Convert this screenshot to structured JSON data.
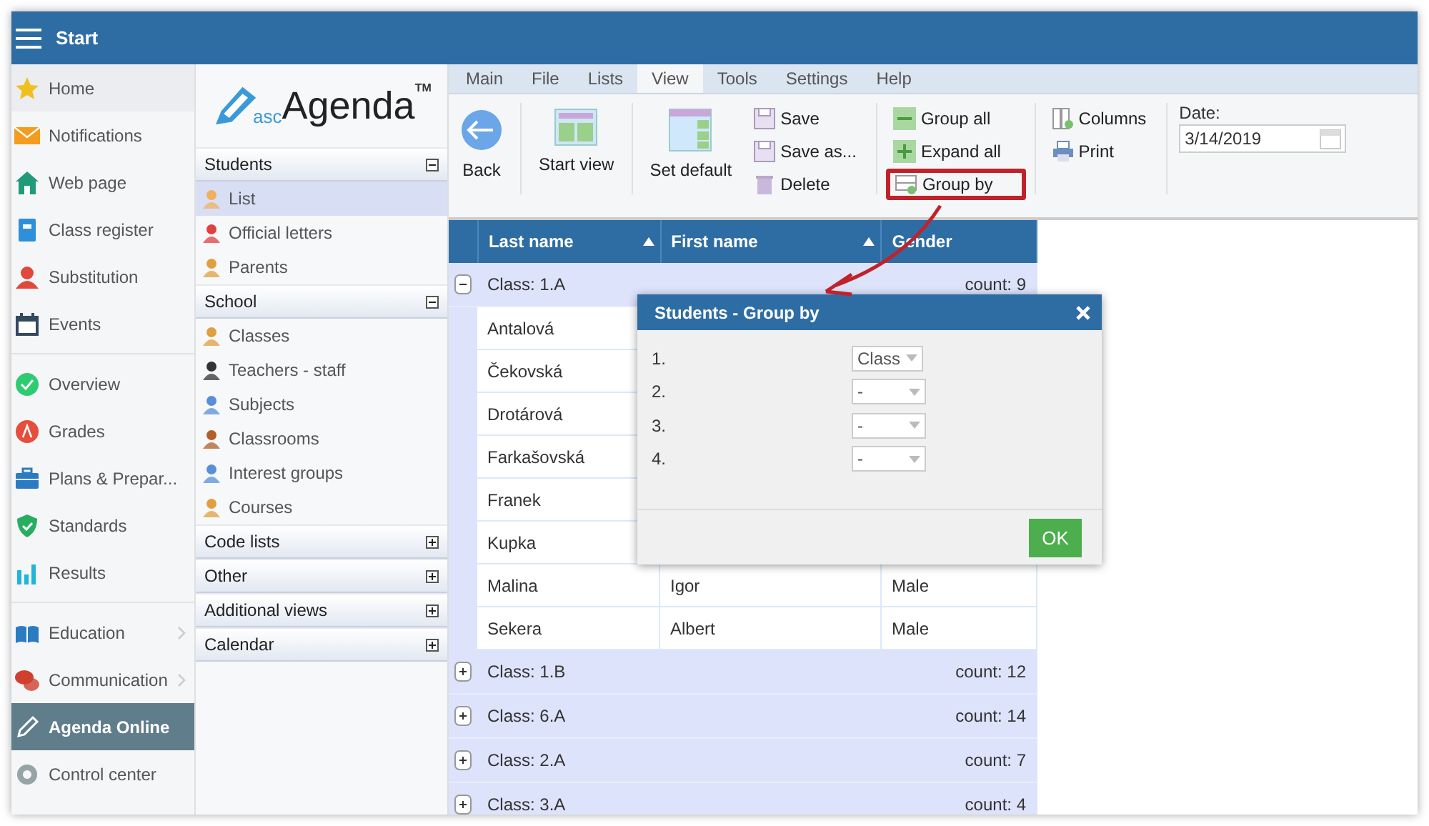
{
  "app_bar": {
    "title": "Start"
  },
  "nav_groups": [
    [
      {
        "label": "Home",
        "selected": false,
        "submenu": false
      },
      {
        "label": "Notifications",
        "selected": false,
        "submenu": false
      },
      {
        "label": "Web page",
        "selected": false,
        "submenu": false
      },
      {
        "label": "Class register",
        "selected": false,
        "submenu": false
      },
      {
        "label": "Substitution",
        "selected": false,
        "submenu": false
      },
      {
        "label": "Events",
        "selected": false,
        "submenu": false
      }
    ],
    [
      {
        "label": "Overview",
        "selected": false,
        "submenu": false
      },
      {
        "label": "Grades",
        "selected": false,
        "submenu": false
      },
      {
        "label": "Plans & Prepar...",
        "selected": false,
        "submenu": false
      },
      {
        "label": "Standards",
        "selected": false,
        "submenu": false
      },
      {
        "label": "Results",
        "selected": false,
        "submenu": false
      }
    ],
    [
      {
        "label": "Education",
        "selected": false,
        "submenu": true
      },
      {
        "label": "Communication",
        "selected": false,
        "submenu": true
      },
      {
        "label": "Agenda Online",
        "selected": true,
        "submenu": false
      },
      {
        "label": "Control center",
        "selected": false,
        "submenu": false
      }
    ]
  ],
  "logo": {
    "prefix": "asc",
    "name": "Agenda",
    "mark": "TM"
  },
  "sections": [
    {
      "title": "Students",
      "expanded": true,
      "items": [
        {
          "label": "List",
          "selected": true
        },
        {
          "label": "Official letters",
          "selected": false
        },
        {
          "label": "Parents",
          "selected": false
        }
      ]
    },
    {
      "title": "School",
      "expanded": true,
      "items": [
        {
          "label": "Classes",
          "selected": false
        },
        {
          "label": "Teachers - staff",
          "selected": false
        },
        {
          "label": "Subjects",
          "selected": false
        },
        {
          "label": "Classrooms",
          "selected": false
        },
        {
          "label": "Interest groups",
          "selected": false
        },
        {
          "label": "Courses",
          "selected": false
        }
      ]
    },
    {
      "title": "Code lists",
      "expanded": false
    },
    {
      "title": "Other",
      "expanded": false
    },
    {
      "title": "Additional views",
      "expanded": false
    },
    {
      "title": "Calendar",
      "expanded": false
    }
  ],
  "menu_tabs": [
    {
      "label": "Main",
      "selected": false
    },
    {
      "label": "File",
      "selected": false
    },
    {
      "label": "Lists",
      "selected": false
    },
    {
      "label": "View",
      "selected": true
    },
    {
      "label": "Tools",
      "selected": false
    },
    {
      "label": "Settings",
      "selected": false
    },
    {
      "label": "Help",
      "selected": false
    }
  ],
  "toolbar": {
    "large": [
      {
        "label": "Back"
      },
      {
        "label": "Start view"
      },
      {
        "label": "Set default"
      }
    ],
    "small_groups": [
      [
        {
          "label": "Save",
          "highlighted": false
        },
        {
          "label": "Save as...",
          "highlighted": false
        },
        {
          "label": "Delete",
          "highlighted": false
        }
      ],
      [
        {
          "label": "Group all",
          "highlighted": false
        },
        {
          "label": "Expand all",
          "highlighted": false
        },
        {
          "label": "Group by",
          "highlighted": true
        }
      ],
      [
        {
          "label": "Columns",
          "highlighted": false
        },
        {
          "label": "Print",
          "highlighted": false
        }
      ]
    ],
    "date": {
      "label": "Date:",
      "value": "3/14/2019"
    }
  },
  "table": {
    "columns": [
      {
        "label": "Last name",
        "sort_arrow": true
      },
      {
        "label": "First name",
        "sort_arrow": true
      },
      {
        "label": "Gender",
        "sort_arrow": false
      }
    ],
    "groups": [
      {
        "label": "Class: 1.A",
        "count": "count: 9",
        "expanded": true,
        "rows": [
          {
            "last_name": "Antalová"
          },
          {
            "last_name": "Čekovská"
          },
          {
            "last_name": "Drotárová"
          },
          {
            "last_name": "Farkašovská"
          },
          {
            "last_name": "Franek"
          },
          {
            "last_name": "Kupka"
          },
          {
            "last_name": "Malina",
            "first_name": "Igor",
            "gender": "Male"
          },
          {
            "last_name": "Sekera",
            "first_name": "Albert",
            "gender": "Male"
          }
        ]
      },
      {
        "label": "Class: 1.B",
        "count": "count: 12",
        "expanded": false
      },
      {
        "label": "Class: 6.A",
        "count": "count: 14",
        "expanded": false
      },
      {
        "label": "Class: 2.A",
        "count": "count: 7",
        "expanded": false
      },
      {
        "label": "Class: 3.A",
        "count": "count: 4",
        "expanded": false
      }
    ]
  },
  "dialog": {
    "title": "Students - Group by",
    "levels": [
      {
        "number": "1.",
        "value": "Class"
      },
      {
        "number": "2.",
        "value": "-"
      },
      {
        "number": "3.",
        "value": "-"
      },
      {
        "number": "4.",
        "value": "-"
      }
    ],
    "ok": "OK"
  }
}
